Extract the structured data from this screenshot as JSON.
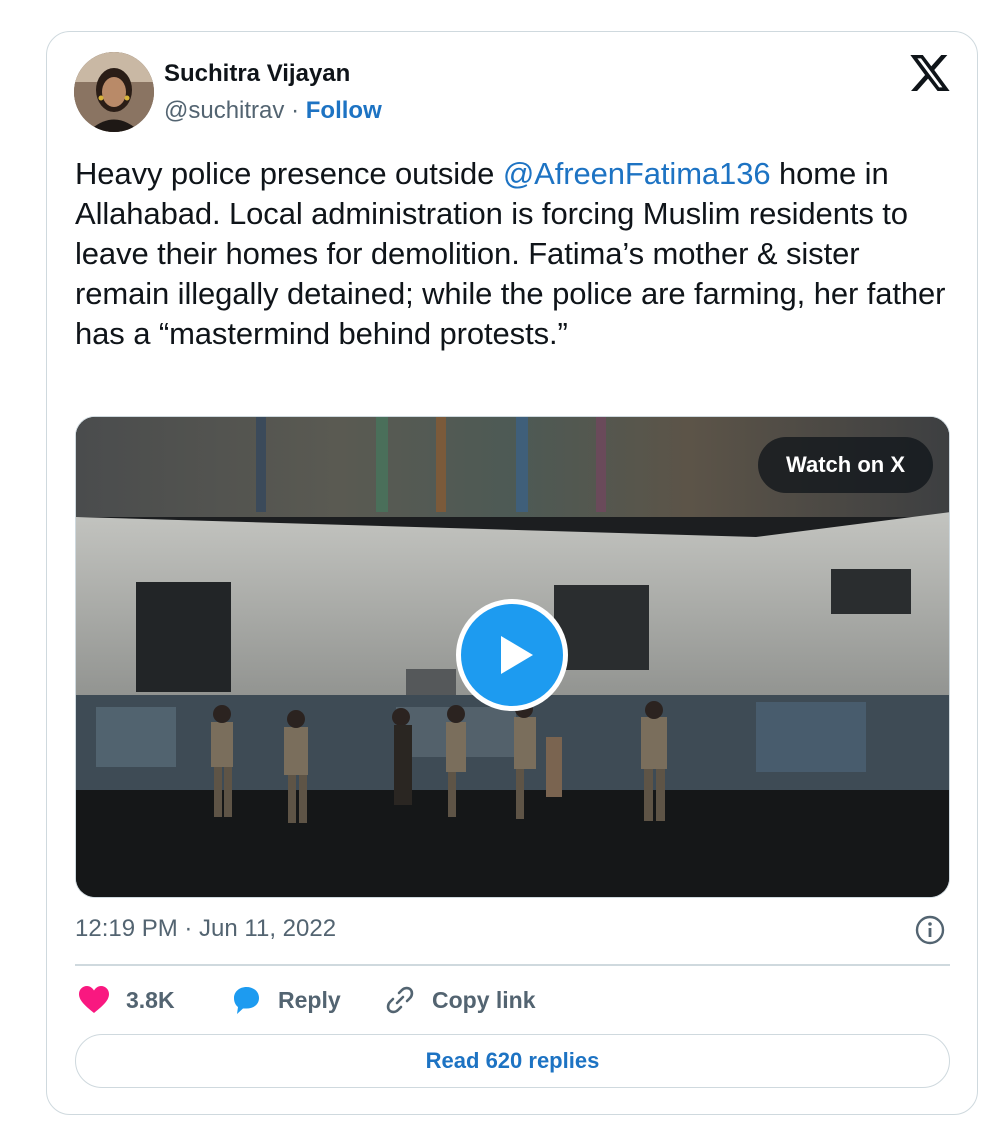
{
  "author": {
    "name": "Suchitra Vijayan",
    "handle": "@suchitrav",
    "separator": "·",
    "follow_label": "Follow"
  },
  "tweet": {
    "text_before": "Heavy police presence outside ",
    "mention": "@AfreenFatima136",
    "text_after": " home in Allahabad. Local administration is forcing Muslim residents to leave their homes for demolition. Fatima’s mother & sister remain illegally detained; while the police are farming, her father has a “mastermind behind protests.”"
  },
  "media": {
    "watch_label": "Watch on X"
  },
  "meta": {
    "timestamp": "12:19 PM · Jun 11, 2022"
  },
  "actions": {
    "likes": "3.8K",
    "reply_label": "Reply",
    "copy_link_label": "Copy link"
  },
  "read_replies_label": "Read 620 replies",
  "colors": {
    "link": "#1d73c3",
    "play": "#1d9bf0",
    "heart": "#f91880",
    "reply_bubble": "#1d9bf0"
  },
  "icons": [
    "x-logo-icon",
    "play-icon",
    "info-icon",
    "heart-icon",
    "reply-bubble-icon",
    "link-icon"
  ]
}
